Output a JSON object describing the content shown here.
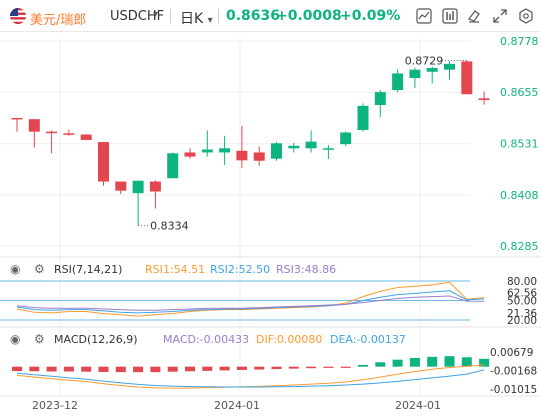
{
  "header": {
    "pair_cn": "美元/瑞郎",
    "pair_en": "USDCHF",
    "caret": "▾",
    "period": "日K",
    "period_caret": "▾",
    "price": "0.8636",
    "change": "+0.0008",
    "change_pct": "+0.09%",
    "tools": [
      "line-chart-icon",
      "indicator-icon",
      "eraser-icon",
      "layout-icon",
      "expand-icon",
      "settings-icon"
    ]
  },
  "colors": {
    "up": "#0eb47f",
    "down": "#e2474f",
    "accent": "#ff7b2c"
  },
  "chart_data": [
    {
      "type": "candlestick",
      "title": "",
      "yaxis_ticks": [
        "0.8778",
        "0.8655",
        "0.8531",
        "0.8408",
        "0.8285"
      ],
      "xaxis_ticks": [
        "2023-12",
        "2024-01",
        "2024-01"
      ],
      "annotations": {
        "high": "0.8729",
        "low": "0.8334"
      },
      "candles": [
        {
          "o": 0.8593,
          "h": 0.8593,
          "l": 0.856,
          "c": 0.859
        },
        {
          "o": 0.859,
          "h": 0.859,
          "l": 0.8522,
          "c": 0.856
        },
        {
          "o": 0.856,
          "h": 0.8563,
          "l": 0.8508,
          "c": 0.8558
        },
        {
          "o": 0.8556,
          "h": 0.8565,
          "l": 0.855,
          "c": 0.8553
        },
        {
          "o": 0.8553,
          "h": 0.8554,
          "l": 0.854,
          "c": 0.854
        },
        {
          "o": 0.8535,
          "h": 0.8535,
          "l": 0.843,
          "c": 0.844
        },
        {
          "o": 0.844,
          "h": 0.844,
          "l": 0.841,
          "c": 0.8418
        },
        {
          "o": 0.8412,
          "h": 0.8442,
          "l": 0.8334,
          "c": 0.8442
        },
        {
          "o": 0.844,
          "h": 0.8443,
          "l": 0.8375,
          "c": 0.8416
        },
        {
          "o": 0.8448,
          "h": 0.851,
          "l": 0.8448,
          "c": 0.8508
        },
        {
          "o": 0.851,
          "h": 0.852,
          "l": 0.8495,
          "c": 0.85
        },
        {
          "o": 0.851,
          "h": 0.8563,
          "l": 0.85,
          "c": 0.8517
        },
        {
          "o": 0.851,
          "h": 0.855,
          "l": 0.848,
          "c": 0.852
        },
        {
          "o": 0.8514,
          "h": 0.8574,
          "l": 0.8473,
          "c": 0.8491
        },
        {
          "o": 0.851,
          "h": 0.8524,
          "l": 0.8478,
          "c": 0.849
        },
        {
          "o": 0.8495,
          "h": 0.8535,
          "l": 0.849,
          "c": 0.8532
        },
        {
          "o": 0.852,
          "h": 0.8533,
          "l": 0.851,
          "c": 0.8526
        },
        {
          "o": 0.852,
          "h": 0.8563,
          "l": 0.851,
          "c": 0.8536
        },
        {
          "o": 0.852,
          "h": 0.8528,
          "l": 0.8494,
          "c": 0.852
        },
        {
          "o": 0.853,
          "h": 0.856,
          "l": 0.8525,
          "c": 0.8558
        },
        {
          "o": 0.8564,
          "h": 0.8628,
          "l": 0.856,
          "c": 0.8622
        },
        {
          "o": 0.8624,
          "h": 0.866,
          "l": 0.8595,
          "c": 0.8655
        },
        {
          "o": 0.866,
          "h": 0.871,
          "l": 0.8655,
          "c": 0.87
        },
        {
          "o": 0.8689,
          "h": 0.8714,
          "l": 0.8665,
          "c": 0.8709
        },
        {
          "o": 0.8704,
          "h": 0.8716,
          "l": 0.8676,
          "c": 0.8713
        },
        {
          "o": 0.8709,
          "h": 0.8729,
          "l": 0.8685,
          "c": 0.8723
        },
        {
          "o": 0.8729,
          "h": 0.8731,
          "l": 0.865,
          "c": 0.865
        },
        {
          "o": 0.864,
          "h": 0.8657,
          "l": 0.8625,
          "c": 0.8636
        }
      ]
    },
    {
      "type": "line",
      "title": "RSI(7,14,21)",
      "legend": [
        {
          "name": "RSI1:54.51",
          "color": "#ff9a2e"
        },
        {
          "name": "RSI2:52.50",
          "color": "#3ea4e6"
        },
        {
          "name": "RSI3:48.86",
          "color": "#9c7ccd"
        }
      ],
      "ylim": [
        20,
        80
      ],
      "yaxis_ticks": [
        "80.00",
        "62.56",
        "50.00",
        "20.00"
      ],
      "yaxis_overlay_ticks": [
        "21.36"
      ],
      "series": [
        {
          "name": "RSI1",
          "values": [
            37,
            32,
            31,
            33,
            33,
            30,
            28,
            26,
            28,
            30,
            33,
            35,
            36,
            36,
            37,
            38,
            39,
            40,
            42,
            46,
            56,
            64,
            70,
            72,
            74,
            78,
            52,
            54.51
          ]
        },
        {
          "name": "RSI2",
          "values": [
            40,
            36,
            35,
            36,
            36,
            34,
            32,
            31,
            32,
            33,
            35,
            36,
            37,
            37,
            38,
            39,
            40,
            41,
            42,
            44,
            50,
            55,
            59,
            61,
            63,
            65,
            51,
            52.5
          ]
        },
        {
          "name": "RSI3",
          "values": [
            42,
            39,
            38,
            38,
            38,
            37,
            36,
            35,
            35,
            36,
            37,
            38,
            38,
            38,
            39,
            40,
            41,
            42,
            43,
            44,
            47,
            50,
            53,
            55,
            56,
            57,
            49,
            48.86
          ]
        }
      ]
    },
    {
      "type": "bar",
      "title": "MACD(12,26,9)",
      "legend": [
        {
          "name": "MACD:-0.00433",
          "color": "#9c7ccd"
        },
        {
          "name": "DIF:0.00080",
          "color": "#ff9a2e"
        },
        {
          "name": "DEA:-0.00137",
          "color": "#3ea4e6"
        }
      ],
      "ylim": [
        -0.0125,
        0.009
      ],
      "yaxis_ticks": [
        "0.00679",
        "-0.00168",
        "-0.01015"
      ],
      "series": [
        {
          "name": "MACD",
          "values": [
            -0.002,
            -0.0021,
            -0.0022,
            -0.0022,
            -0.0023,
            -0.0024,
            -0.0025,
            -0.0025,
            -0.0025,
            -0.0023,
            -0.0021,
            -0.0019,
            -0.0017,
            -0.0015,
            -0.0013,
            -0.0011,
            -0.0009,
            -0.0007,
            -0.0005,
            -0.0001,
            0.0008,
            0.002,
            0.0032,
            0.004,
            0.0045,
            0.0048,
            0.0043,
            0.0036
          ]
        },
        {
          "name": "DIF",
          "values": [
            -0.004,
            -0.0048,
            -0.0055,
            -0.0062,
            -0.0068,
            -0.0078,
            -0.0086,
            -0.0093,
            -0.0097,
            -0.0098,
            -0.0098,
            -0.0096,
            -0.0094,
            -0.0092,
            -0.009,
            -0.0087,
            -0.0084,
            -0.008,
            -0.0076,
            -0.007,
            -0.006,
            -0.0048,
            -0.0034,
            -0.0022,
            -0.0012,
            -0.0004,
            0.0002,
            0.0008
          ]
        },
        {
          "name": "DEA",
          "values": [
            -0.003,
            -0.0037,
            -0.0044,
            -0.0051,
            -0.0057,
            -0.0066,
            -0.0074,
            -0.0081,
            -0.0086,
            -0.0089,
            -0.0091,
            -0.0092,
            -0.0093,
            -0.0093,
            -0.0093,
            -0.0092,
            -0.0091,
            -0.0089,
            -0.0087,
            -0.0084,
            -0.008,
            -0.0074,
            -0.0067,
            -0.0059,
            -0.0051,
            -0.0043,
            -0.0034,
            -0.0014
          ]
        }
      ]
    }
  ]
}
